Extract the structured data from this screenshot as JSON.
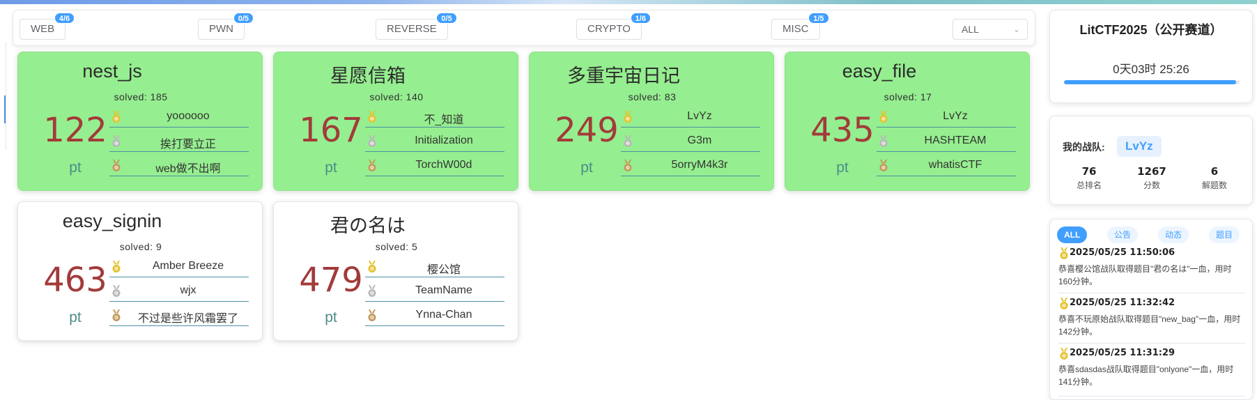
{
  "filter_tabs": [
    {
      "label": "WEB",
      "badge": "4/6",
      "active": true
    },
    {
      "label": "PWN",
      "badge": "0/5",
      "active": false
    },
    {
      "label": "REVERSE",
      "badge": "0/5",
      "active": false
    },
    {
      "label": "CRYPTO",
      "badge": "1/6",
      "active": false
    },
    {
      "label": "MISC",
      "badge": "1/5",
      "active": false
    }
  ],
  "category_select": {
    "value": "ALL"
  },
  "challenges": [
    {
      "name": "nest_js",
      "solved": "solved: 185",
      "points": "122",
      "unit": "pt",
      "solved_by_me": true,
      "top3": [
        "yoooooo",
        "挨打要立正",
        "web做不出啊"
      ]
    },
    {
      "name": "星愿信箱",
      "solved": "solved: 140",
      "points": "167",
      "unit": "pt",
      "solved_by_me": true,
      "top3": [
        "不_知道",
        "Initialization",
        "TorchW00d"
      ]
    },
    {
      "name": "多重宇宙日记",
      "solved": "solved: 83",
      "points": "249",
      "unit": "pt",
      "solved_by_me": true,
      "top3": [
        "LvYz",
        "G3m",
        "5orryM4k3r"
      ]
    },
    {
      "name": "easy_file",
      "solved": "solved: 17",
      "points": "435",
      "unit": "pt",
      "solved_by_me": true,
      "top3": [
        "LvYz",
        "HASHTEAM",
        "whatisCTF"
      ]
    },
    {
      "name": "easy_signin",
      "solved": "solved: 9",
      "points": "463",
      "unit": "pt",
      "solved_by_me": false,
      "top3": [
        "Amber Breeze",
        "wjx",
        "不过是些许风霜罢了"
      ]
    },
    {
      "name": "君の名は",
      "solved": "solved: 5",
      "points": "479",
      "unit": "pt",
      "solved_by_me": false,
      "top3": [
        "樱公馆",
        "TeamName",
        "Ynna-Chan"
      ]
    }
  ],
  "medal_colors": {
    "gold": "#e6c22e",
    "silver": "#b8b8b8",
    "bronze": "#c49a5a"
  },
  "event": {
    "title": "LitCTF2025（公开赛道）",
    "countdown": "0天03时 25:26",
    "progress_percent": 98
  },
  "my_team": {
    "label": "我的战队:",
    "name": "LvYz",
    "stats": [
      {
        "value": "76",
        "label": "总排名"
      },
      {
        "value": "1267",
        "label": "分数"
      },
      {
        "value": "6",
        "label": "解题数"
      }
    ]
  },
  "feed": {
    "tabs": [
      {
        "label": "ALL",
        "active": true
      },
      {
        "label": "公告",
        "active": false
      },
      {
        "label": "动态",
        "active": false
      },
      {
        "label": "题目",
        "active": false
      }
    ],
    "items": [
      {
        "time": "2025/05/25 11:50:06",
        "text": "恭喜樱公馆战队取得题目\"君の名は\"一血，用时160分钟。"
      },
      {
        "time": "2025/05/25 11:32:42",
        "text": "恭喜不玩原始战队取得题目\"new_bag\"一血，用时142分钟。"
      },
      {
        "time": "2025/05/25 11:31:29",
        "text": "恭喜sdasdas战队取得题目\"onlyone\"一血，用时141分钟。"
      }
    ]
  }
}
